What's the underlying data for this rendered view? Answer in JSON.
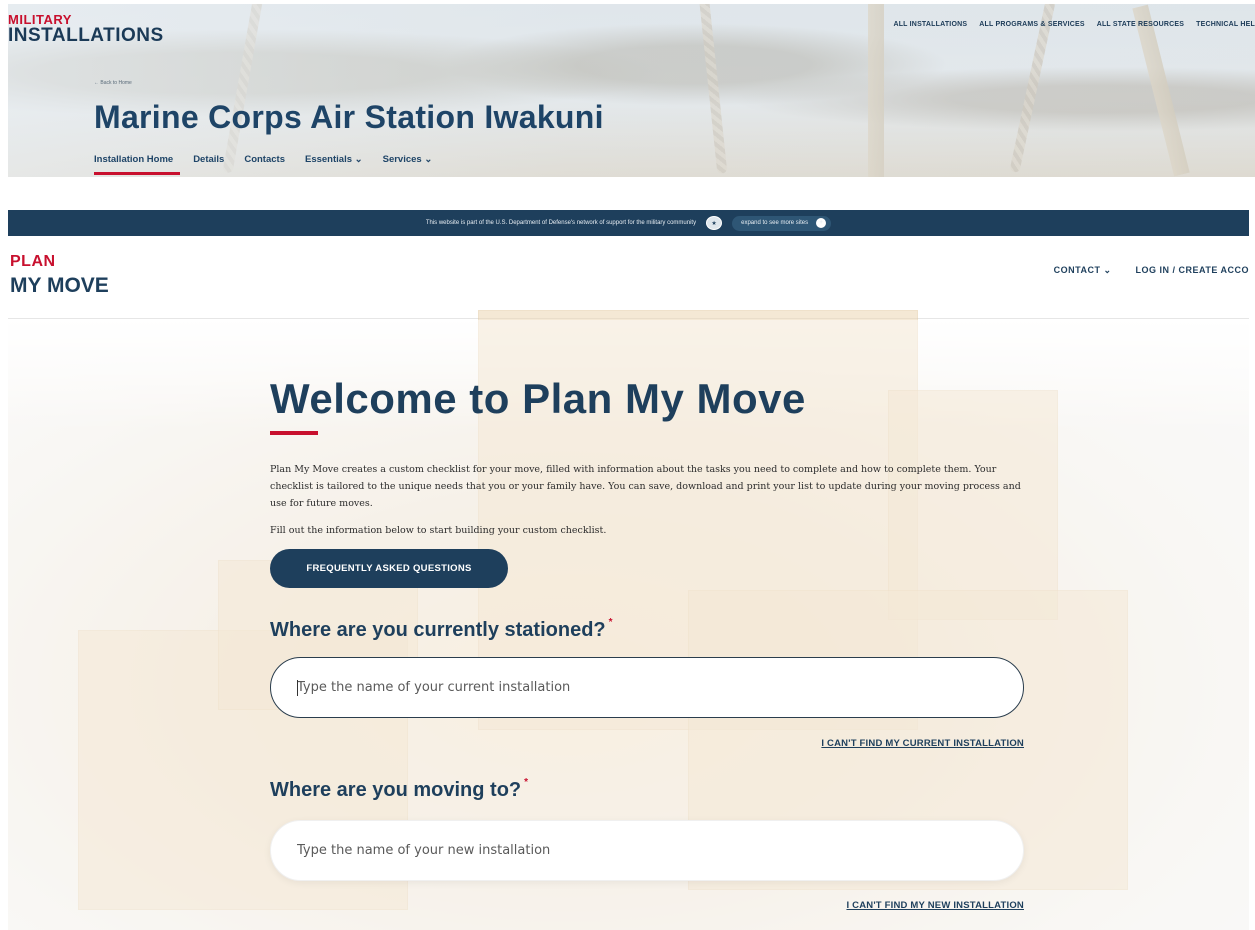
{
  "military_installations": {
    "logo_line1": "MILITARY",
    "logo_line2": "INSTALLATIONS",
    "nav": [
      "ALL INSTALLATIONS",
      "ALL PROGRAMS & SERVICES",
      "ALL STATE RESOURCES",
      "TECHNICAL HEL"
    ],
    "back_link": "← Back to Home",
    "title": "Marine Corps Air Station Iwakuni",
    "tabs": [
      "Installation Home",
      "Details",
      "Contacts",
      "Essentials ⌄",
      "Services ⌄"
    ],
    "active_tab": "Installation Home"
  },
  "plan_my_move": {
    "banner": {
      "text": "This website is part of the U.S. Department of Defense's network of support for the military community",
      "expand_label": "expand to see more sites",
      "expand_icon": "+"
    },
    "logo_line1": "PLAN",
    "logo_line2": "MY MOVE",
    "header_nav": [
      "CONTACT ⌄",
      "LOG IN / CREATE ACCOUNT"
    ],
    "heading": "Welcome to Plan My Move",
    "intro": "Plan My Move creates a custom checklist for your move, filled with information about the tasks you need to complete and how to complete them. Your checklist is tailored to the unique needs that you or your family have. You can save, download and print your list to update during your moving process and use for future moves.",
    "fill_text": "Fill out the information below to start building your custom checklist.",
    "faq_button": "FREQUENTLY ASKED QUESTIONS",
    "q_current": "Where are you currently stationed?",
    "q_moving": "Where are you moving to?",
    "required_mark": "*",
    "current_placeholder": "Type the name of your current installation",
    "new_placeholder": "Type the name of your new installation",
    "link_current": "I CAN'T FIND MY CURRENT INSTALLATION",
    "link_new": "I CAN'T FIND MY NEW INSTALLATION",
    "colors": {
      "navy": "#1e3f5c",
      "red": "#c8102e"
    }
  }
}
